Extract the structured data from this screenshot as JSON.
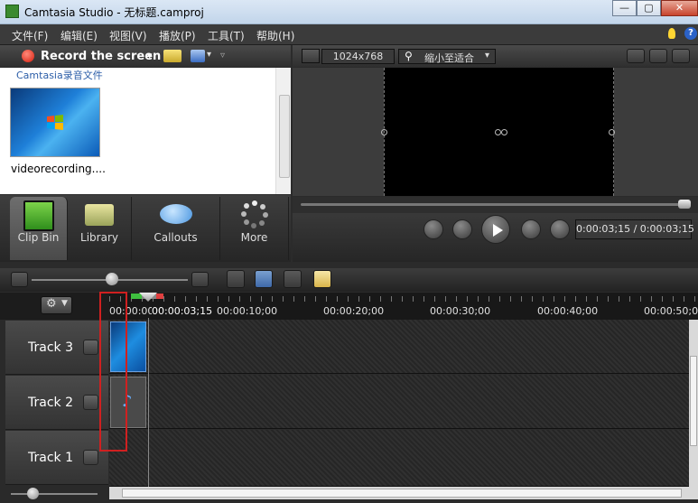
{
  "window": {
    "title": "Camtasia Studio - 无标题.camproj",
    "minimize_label": "—",
    "maximize_label": "▢",
    "close_label": "✕"
  },
  "menu": [
    "文件(F)",
    "编辑(E)",
    "视图(V)",
    "播放(P)",
    "工具(T)",
    "帮助(H)"
  ],
  "record": {
    "label": "Record the screen",
    "dropdown_glyph": "▾"
  },
  "clipbin": {
    "folder_header": "Camtasia录音文件",
    "clip_caption": "videorecording...."
  },
  "tabs": [
    {
      "label": "Clip Bin",
      "icon": "film-strip-icon",
      "active": true
    },
    {
      "label": "Library",
      "icon": "library-folder-icon",
      "active": false
    },
    {
      "label": "Callouts",
      "icon": "speech-bubble-icon",
      "active": false
    },
    {
      "label": "More",
      "icon": "more-dots-icon",
      "active": false
    }
  ],
  "preview": {
    "resolution": "1024x768",
    "zoom": "缩小至适合",
    "time_display": "0:00:03;15 / 0:00:03;15"
  },
  "timeline": {
    "settings_glyph": "⚙",
    "playhead_time": "00:00:03;15",
    "ruler_labels": [
      "00:00:00",
      "00:00:10;00",
      "00:00:20;00",
      "00:00:30;00",
      "00:00:40;00",
      "00:00:50;00"
    ],
    "tracks": [
      {
        "label": "Track 3",
        "clip": "video-clip"
      },
      {
        "label": "Track 2",
        "clip": "audio-clip"
      },
      {
        "label": "Track 1",
        "clip": ""
      }
    ]
  },
  "colors": {
    "accent_red": "#d02020",
    "record_red": "#d61d0d"
  }
}
